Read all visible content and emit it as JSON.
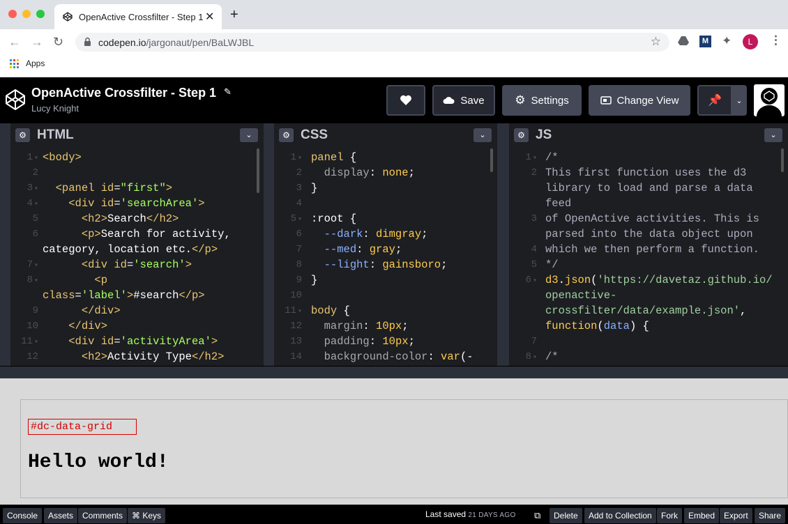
{
  "browser": {
    "tab_title": "OpenActive Crossfilter - Step 1",
    "url_host": "codepen.io",
    "url_path": "/jargonaut/pen/BaLWJBL",
    "bookmark_apps": "Apps",
    "profile_initial": "L"
  },
  "header": {
    "title": "OpenActive Crossfilter - Step 1",
    "author": "Lucy Knight",
    "save_label": "Save",
    "settings_label": "Settings",
    "change_view_label": "Change View"
  },
  "panels": {
    "html_label": "HTML",
    "css_label": "CSS",
    "js_label": "JS"
  },
  "result": {
    "grid_label": "#dc-data-grid",
    "hello": "Hello world!"
  },
  "footer": {
    "console": "Console",
    "assets": "Assets",
    "comments": "Comments",
    "keys": "⌘ Keys",
    "last_saved": "Last saved",
    "saved_ago": "21 DAYS AGO",
    "delete": "Delete",
    "add_collection": "Add to Collection",
    "fork": "Fork",
    "embed": "Embed",
    "export": "Export",
    "share": "Share"
  },
  "colors": {
    "brand_bg": "#000000",
    "button_bg": "#444857",
    "editor_bg": "#1d1e22"
  }
}
